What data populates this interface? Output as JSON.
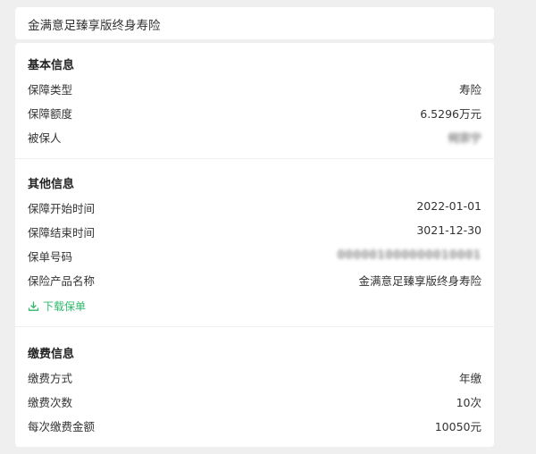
{
  "title": "金满意足臻享版终身寿险",
  "sections": {
    "basic": {
      "heading": "基本信息",
      "rows": [
        {
          "label": "保障类型",
          "value": "寿险"
        },
        {
          "label": "保障额度",
          "value": "6.5296万元"
        },
        {
          "label": "被保人",
          "value": "何宗宁"
        }
      ]
    },
    "other": {
      "heading": "其他信息",
      "rows": [
        {
          "label": "保障开始时间",
          "value": "2022-01-01"
        },
        {
          "label": "保障结束时间",
          "value": "3021-12-30"
        },
        {
          "label": "保单号码",
          "value": "000001000000010001"
        },
        {
          "label": "保险产品名称",
          "value": "金满意足臻享版终身寿险"
        }
      ],
      "download_label": "下载保单"
    },
    "payment": {
      "heading": "缴费信息",
      "rows": [
        {
          "label": "缴费方式",
          "value": "年缴"
        },
        {
          "label": "缴费次数",
          "value": "10次"
        },
        {
          "label": "每次缴费金额",
          "value": "10050元"
        }
      ]
    }
  },
  "icons": {
    "download": "download-icon"
  },
  "colors": {
    "accent": "#2eb86b",
    "background": "#efefef",
    "card": "#ffffff"
  }
}
